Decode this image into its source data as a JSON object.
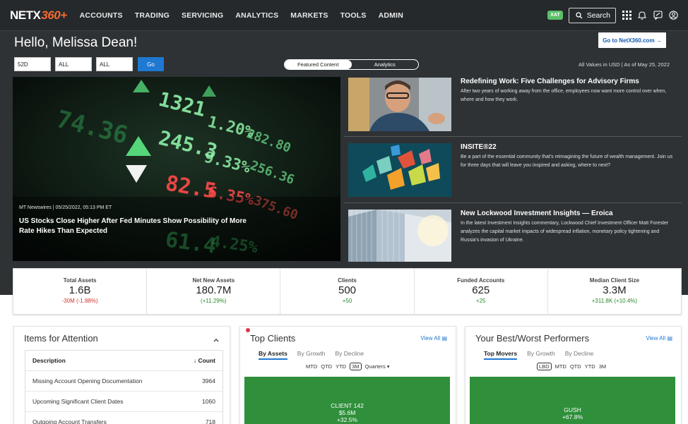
{
  "nav": {
    "logo_main": "NETX",
    "logo_accent": "360+",
    "items": [
      "ACCOUNTS",
      "TRADING",
      "SERVICING",
      "ANALYTICS",
      "MARKETS",
      "TOOLS",
      "ADMIN"
    ],
    "badge": "XAT",
    "search_label": "Search",
    "icons": [
      "grid-icon",
      "bell-icon",
      "chat-icon",
      "user-icon"
    ]
  },
  "header": {
    "greeting": "Hello, Melissa Dean!",
    "goto_label": "Go to NetX360.com →"
  },
  "filters": {
    "period": "52D",
    "filter2": "ALL",
    "filter3": "ALL",
    "go_label": "Go"
  },
  "toggle": {
    "options": [
      "Featured Content",
      "Analytics"
    ],
    "active": "Featured Content"
  },
  "values_note": "All Values in USD | As of May 25, 2022",
  "main_story": {
    "meta": "MT Newswires | 05/25/2022, 05:13 PM ET",
    "title": "US Stocks Close Higher After Fed Minutes Show Possibility of More Rate Hikes Than Expected",
    "ticker_numbers": [
      "74.36",
      "1321",
      "245.3",
      "1.20%",
      "9.33%",
      "82.5",
      "6.35%",
      "61.4",
      "4.25%",
      "282.80",
      "256.36",
      "375.60"
    ]
  },
  "side_stories": [
    {
      "title": "Redefining Work: Five Challenges for Advisory Firms",
      "text": "After two years of working away from the office, employees now want more control over when, where and how they work."
    },
    {
      "title": "INSITE®22",
      "text": "Be a part of the essential community that's reimagining the future of wealth management. Join us for three days that will leave you inspired and asking, where to next?"
    },
    {
      "title": "New Lockwood Investment Insights — Eroica",
      "text": "In the latest Investment Insights commentary, Lockwood Chief Investment Officer Matt Forester analyzes the capital market impacts of widespread inflation, monetary policy tightening and Russia's invasion of Ukraine."
    }
  ],
  "stats": [
    {
      "label": "Total Assets",
      "value": "1.6B",
      "change": "-30M (-1.88%)",
      "trend": "neg"
    },
    {
      "label": "Net New Assets",
      "value": "180.7M",
      "change": "(+11.29%)",
      "trend": "pos"
    },
    {
      "label": "Clients",
      "value": "500",
      "change": "+50",
      "trend": "pos"
    },
    {
      "label": "Funded Accounts",
      "value": "625",
      "change": "+25",
      "trend": "pos"
    },
    {
      "label": "Median Client Size",
      "value": "3.3M",
      "change": "+311.8K (+10.4%)",
      "trend": "pos"
    }
  ],
  "attention": {
    "title": "Items for Attention",
    "col_desc": "Description",
    "col_count": "↓ Count",
    "rows": [
      {
        "desc": "Missing Account Opening Documentation",
        "count": "3964"
      },
      {
        "desc": "Upcoming Significant Client Dates",
        "count": "1060"
      },
      {
        "desc": "Outgoing Account Transfers",
        "count": "718"
      }
    ]
  },
  "top_clients": {
    "title": "Top Clients",
    "view_all": "View All",
    "tabs": [
      "By Assets",
      "By Growth",
      "By Decline"
    ],
    "periods": [
      "MTD",
      "QTD",
      "YTD",
      "3M",
      "Quarters ▾"
    ],
    "selected_period": "3M",
    "block": {
      "name": "CLIENT 142",
      "value": "$5.6M",
      "change": "+32.5%"
    }
  },
  "performers": {
    "title": "Your Best/Worst Performers",
    "view_all": "View All",
    "tabs": [
      "Top Movers",
      "By Growth",
      "By Decline"
    ],
    "periods": [
      "LBD",
      "MTD",
      "QTD",
      "YTD",
      "3M"
    ],
    "selected_period": "LBD",
    "block": {
      "name": "GUSH",
      "change": "+67.8%"
    }
  },
  "colors": {
    "hero_bg": "#2e3235",
    "accent_orange": "#f26a2e",
    "primary_blue": "#1f78d1",
    "positive": "#2a8a2a",
    "negative": "#d0342c",
    "block_green": "#2f8f3a"
  }
}
